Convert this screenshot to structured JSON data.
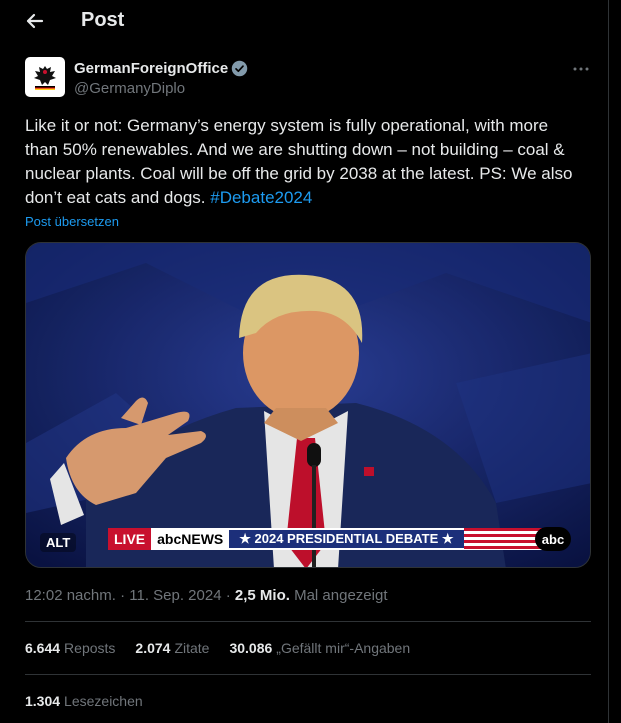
{
  "header": {
    "title": "Post",
    "back_icon": "arrow-left-icon"
  },
  "author": {
    "display_name": "GermanForeignOffice",
    "handle": "@GermanyDiplo",
    "verified": true,
    "verified_color": "#829aab",
    "avatar_icon": "federal-eagle-icon"
  },
  "post": {
    "text": "Like it or not: Germany’s energy system is fully operational, with more than 50% renewables. And we are shutting down – not building – coal & nuclear plants. Coal will be off the grid by 2038 at the latest. PS: We also don’t eat cats and dogs. ",
    "hashtag": "#Debate2024",
    "translate_label": "Post übersetzen",
    "hashtag_color": "#1d9bf0"
  },
  "media": {
    "alt_badge": "ALT",
    "lower_third": {
      "live": "LIVE",
      "network": "abcNEWS",
      "banner": "★ 2024 PRESIDENTIAL DEBATE ★"
    },
    "corner_logo": "abc"
  },
  "meta": {
    "time": "12:02 nachm.",
    "date": "11. Sep. 2024",
    "views_count": "2,5 Mio.",
    "views_label": "Mal angezeigt"
  },
  "stats": {
    "reposts_count": "6.644",
    "reposts_label": "Reposts",
    "quotes_count": "2.074",
    "quotes_label": "Zitate",
    "likes_count": "30.086",
    "likes_label": "„Gefällt mir“-Angaben"
  },
  "bookmarks": {
    "count": "1.304",
    "label": "Lesezeichen"
  }
}
